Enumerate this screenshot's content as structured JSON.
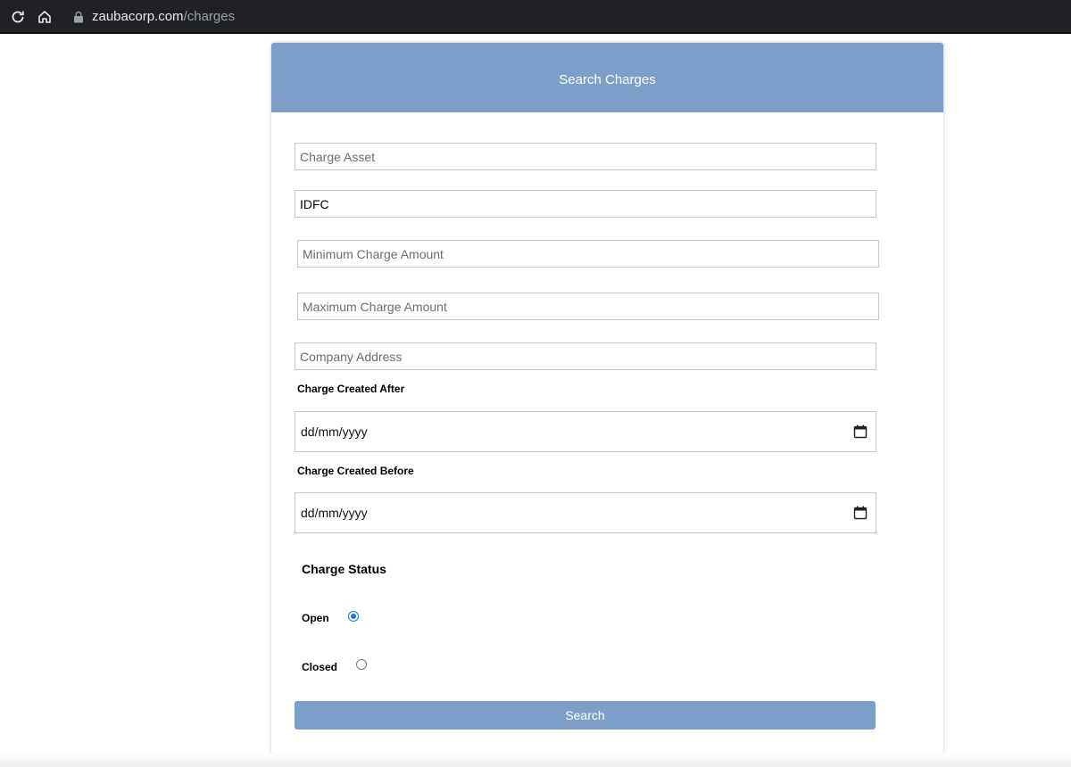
{
  "browser": {
    "domain": "zaubacorp.com",
    "path": "/charges"
  },
  "form": {
    "title": "Search Charges",
    "charge_asset": {
      "placeholder": "Charge Asset",
      "value": ""
    },
    "charge_holder": {
      "value": "IDFC"
    },
    "min_amount": {
      "placeholder": "Minimum Charge Amount",
      "value": ""
    },
    "max_amount": {
      "placeholder": "Maximum Charge Amount",
      "value": ""
    },
    "company_address": {
      "placeholder": "Company Address",
      "value": ""
    },
    "created_after": {
      "label": "Charge Created After",
      "value": "dd/mm/yyyy"
    },
    "created_before": {
      "label": "Charge Created Before",
      "value": "dd/mm/yyyy"
    },
    "status": {
      "heading": "Charge Status",
      "options": [
        {
          "label": "Open",
          "checked": true
        },
        {
          "label": "Closed",
          "checked": false
        }
      ]
    },
    "submit_label": "Search"
  },
  "colors": {
    "accent": "#7c9fca",
    "radio_checked": "#1a73e8"
  },
  "icons": [
    "reload-icon",
    "home-icon",
    "lock-icon",
    "calendar-icon"
  ]
}
